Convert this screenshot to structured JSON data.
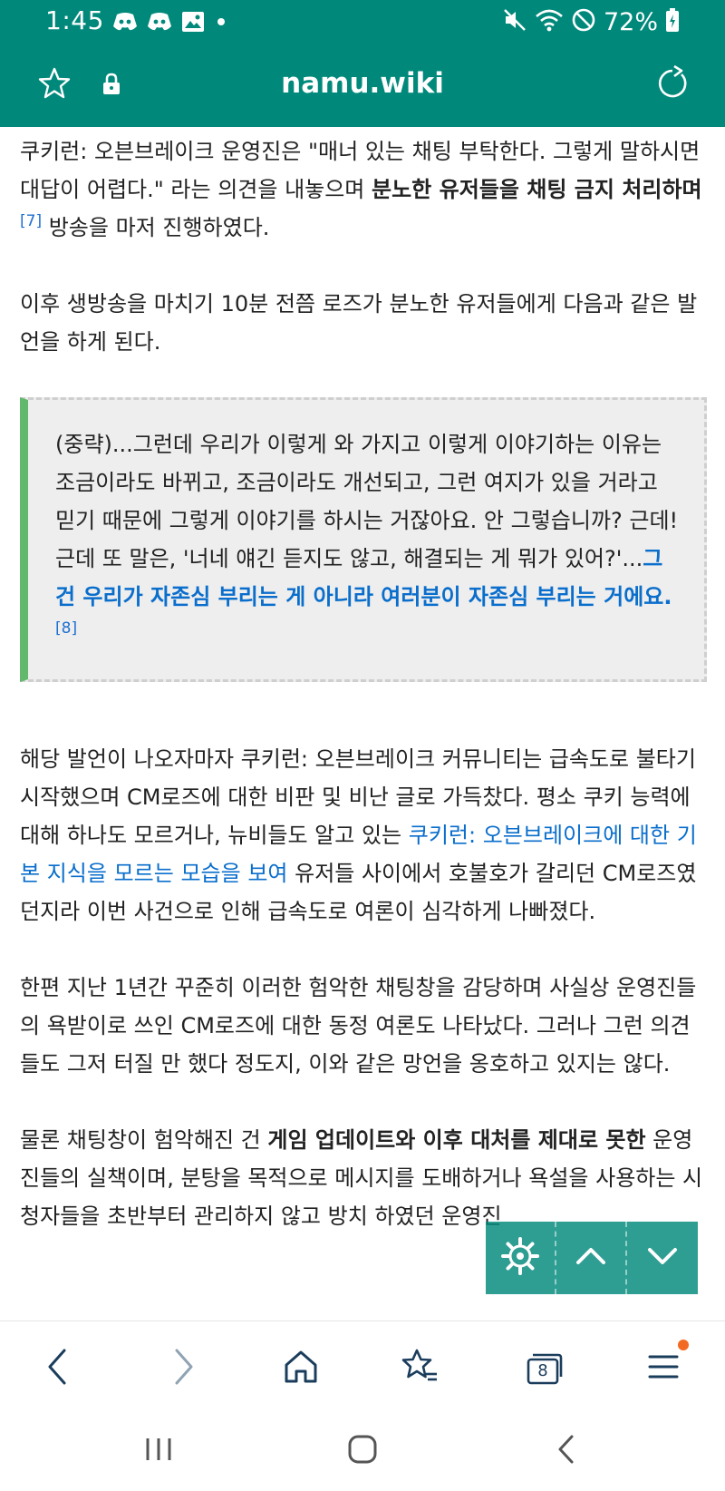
{
  "status_bar": {
    "time": "1:45",
    "battery_text": "72%"
  },
  "address_bar": {
    "url": "namu.wiki"
  },
  "article": {
    "p1": {
      "t1": "쿠키런: 오븐브레이크 운영진은 \"매너 있는 채팅 부탁한다. 그렇게 말하시면 대답이 어렵다.\" 라는 의견을 내놓으며 ",
      "bold": "분노한 유저들을 채팅 금지 처리하며",
      "fn": "[7]",
      "t2": " 방송을 마저 진행하였다."
    },
    "p2": "이후 생방송을 마치기 10분 전쯤 로즈가 분노한 유저들에게 다음과 같은 발언을 하게 된다.",
    "quote": {
      "text": "(중략)...그런데 우리가 이렇게 와 가지고 이렇게 이야기하는 이유는 조금이라도 바뀌고, 조금이라도 개선되고, 그런 여지가 있을 거라고 믿기 때문에 그렇게 이야기를 하시는 거잖아요. 안 그렇습니까? 근데! 근데 또 말은, '너네 얘긴 듣지도 않고, 해결되는 게 뭐가 있어?'...",
      "link": "그건 우리가 자존심 부리는 게 아니라 여러분이 자존심 부리는 거에요.",
      "fn": "[8]"
    },
    "p3": {
      "t1": "해당 발언이 나오자마자 쿠키런: 오븐브레이크 커뮤니티는 급속도로 불타기 시작했으며 CM로즈에 대한 비판 및 비난 글로 가득찼다. 평소 쿠키 능력에 대해 하나도 모르거나, 뉴비들도 알고 있는 ",
      "link": "쿠키런: 오븐브레이크에 대한 기본 지식을 모르는 모습을 보여",
      "t2": " 유저들 사이에서 호불호가 갈리던 CM로즈였던지라 이번 사건으로 인해 급속도로 여론이 심각하게 나빠졌다."
    },
    "p4": "한편 지난 1년간 꾸준히 이러한 험악한 채팅창을 감당하며 사실상 운영진들의 욕받이로 쓰인 CM로즈에 대한 동정 여론도 나타났다. 그러나 그런 의견들도 그저 터질 만 했다 정도지, 이와 같은 망언을 옹호하고 있지는 않다.",
    "p5": {
      "t1": "물론 채팅창이 험악해진 건 ",
      "bold": "게임 업데이트와 이후 대처를 제대로 못한",
      "t2": " 운영진들의 실책이며, 분탕을 목적으로 메시지를 도배하거나 욕설을 사용하는 시청자들을 초반부터 관리하지 않고 방치 하였던 운영진"
    }
  },
  "bottom_nav": {
    "tabs_count": "8"
  },
  "icons": {
    "status": [
      "discord-icon",
      "discord-icon",
      "image-icon",
      "dot-icon",
      "mute-icon",
      "wifi-icon",
      "block-icon",
      "battery-icon"
    ],
    "address": [
      "star-icon",
      "lock-icon",
      "reload-icon"
    ],
    "float": [
      "gear-icon",
      "chevron-up-icon",
      "chevron-down-icon"
    ],
    "nav": [
      "back-icon",
      "forward-icon",
      "home-icon",
      "bookmarks-icon",
      "tabs-icon",
      "menu-icon"
    ],
    "system": [
      "recents-icon",
      "home-button-icon",
      "system-back-icon"
    ]
  },
  "colors": {
    "header": "#00897b",
    "link": "#0a6ecc",
    "quote_bar": "#62b86c",
    "quote_bg": "#eeeeee",
    "notification_dot": "#f26a22"
  }
}
